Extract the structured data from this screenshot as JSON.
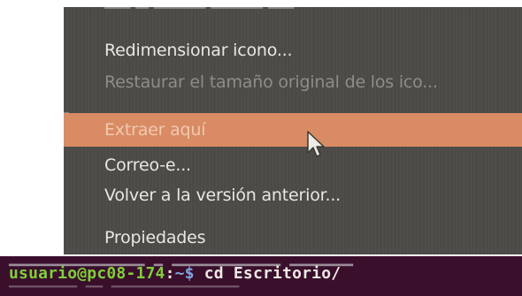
{
  "context_menu": {
    "items": [
      {
        "label": "Redimensionar icono...",
        "state": "enabled"
      },
      {
        "label": "Restaurar el tamaño original de los ico...",
        "state": "disabled"
      },
      {
        "label": "Extraer aquí",
        "state": "highlighted"
      },
      {
        "label": "Correo-e...",
        "state": "enabled"
      },
      {
        "label": "Volver a la versión anterior...",
        "state": "enabled"
      },
      {
        "label": "Propiedades",
        "state": "enabled"
      }
    ],
    "colors": {
      "background": "#4b4a47",
      "highlight": "#d98b63",
      "text": "#e9e7e1",
      "disabled_text": "#8e8d88"
    }
  },
  "cursor": {
    "icon": "arrow-pointer-icon"
  },
  "terminal": {
    "prompt_user": "usuario@pc08-174",
    "prompt_separator": ":",
    "prompt_path": "~$",
    "command": " cd Escritorio/",
    "colors": {
      "background": "#3a0f2c",
      "user": "#7fcf3a",
      "path": "#7da7e0"
    }
  }
}
